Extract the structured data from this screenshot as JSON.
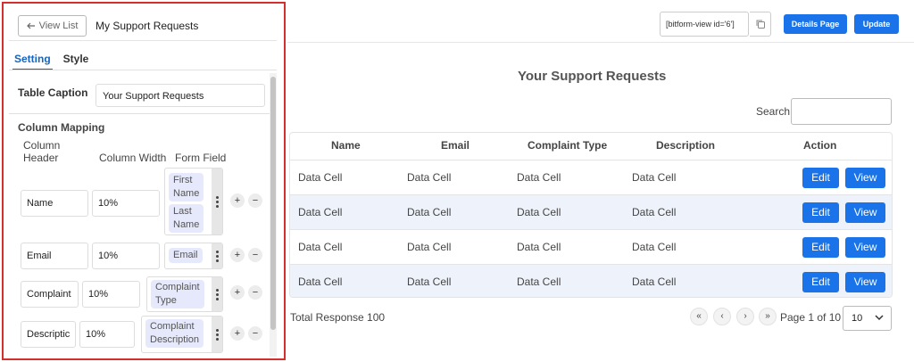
{
  "panel": {
    "view_list_label": "View List",
    "form_title": "My Support Requests",
    "tabs": [
      {
        "label": "Setting",
        "active": true
      },
      {
        "label": "Style",
        "active": false
      }
    ],
    "table_caption_label": "Table Caption",
    "table_caption_value": "Your Support Requests",
    "column_mapping_title": "Column Mapping",
    "headers": {
      "column_header_1": "Column",
      "column_header_2": "Header",
      "column_width": "Column Width",
      "form_field": "Form Field"
    },
    "rows": [
      {
        "header": "Name",
        "width": "10%",
        "fields": [
          "First Name",
          "Last Name"
        ]
      },
      {
        "header": "Email",
        "width": "10%",
        "fields": [
          "Email"
        ]
      },
      {
        "header": "Complaint",
        "width": "10%",
        "fields": [
          "Complaint Type"
        ]
      },
      {
        "header": "Descriptic",
        "width": "10%",
        "fields": [
          "Complaint Description"
        ]
      }
    ],
    "chips": {
      "first_1": "First",
      "first_2": "Name",
      "last_1": "Last",
      "last_2": "Name",
      "email": "Email",
      "ctype_1": "Complaint",
      "ctype_2": "Type",
      "cdesc_1": "Complaint",
      "cdesc_2": "Description"
    },
    "add_symbol": "+",
    "remove_symbol": "−"
  },
  "toolbar": {
    "shortcode": "[bitform-view id='6']",
    "details_page_label": "Details Page",
    "update_label": "Update"
  },
  "table": {
    "title": "Your Support Requests",
    "search_label": "Search",
    "search_value": "",
    "columns": [
      "Name",
      "Email",
      "Complaint Type",
      "Description",
      "Action"
    ],
    "rows": [
      [
        "Data Cell",
        "Data Cell",
        "Data Cell",
        "Data Cell"
      ],
      [
        "Data Cell",
        "Data Cell",
        "Data Cell",
        "Data Cell"
      ],
      [
        "Data Cell",
        "Data Cell",
        "Data Cell",
        "Data Cell"
      ],
      [
        "Data Cell",
        "Data Cell",
        "Data Cell",
        "Data Cell"
      ]
    ],
    "edit_label": "Edit",
    "view_label": "View"
  },
  "footer": {
    "total_response": "Total Response 100",
    "first_symbol": "«",
    "prev_symbol": "‹",
    "next_symbol": "›",
    "last_symbol": "»",
    "page_info": "Page 1 of 10",
    "page_size": "10"
  },
  "colors": {
    "accent": "#1a73e8",
    "highlight_border": "#d32f2f",
    "row_alt": "#eef3fb",
    "chip_bg": "#e6e9fb"
  },
  "icons": [
    "arrow-left-icon",
    "copy-icon",
    "kebab-icon",
    "chevron-down-icon"
  ]
}
